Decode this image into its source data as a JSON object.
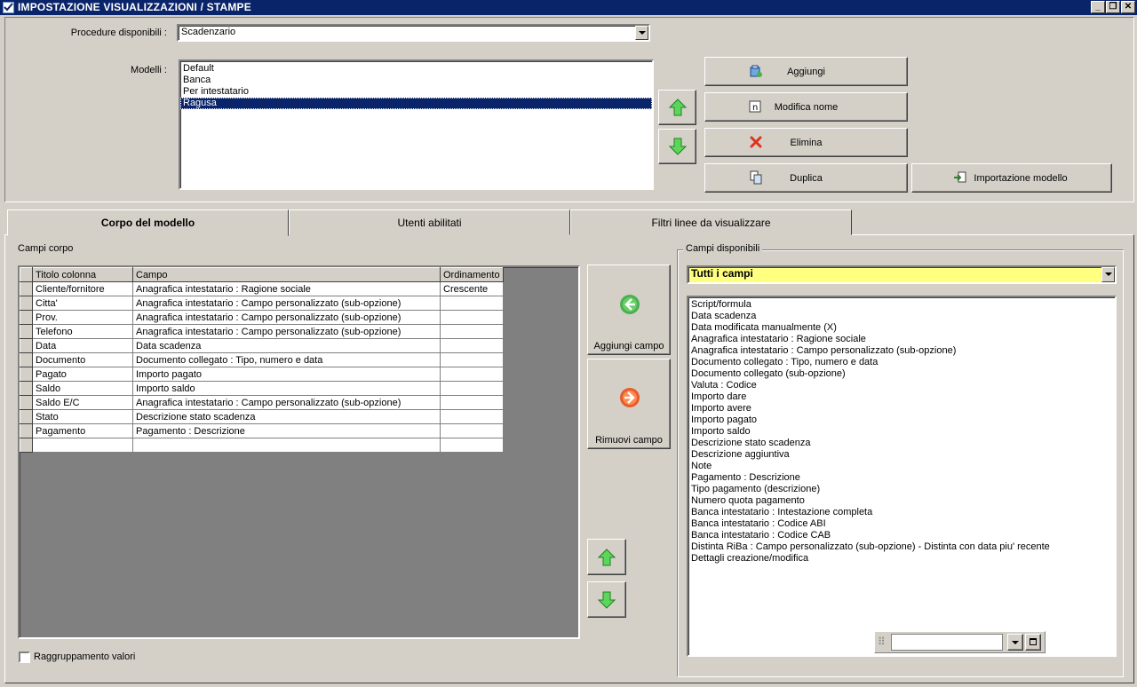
{
  "window": {
    "title": "IMPOSTAZIONE VISUALIZZAZIONI / STAMPE"
  },
  "top": {
    "procedure_label": "Procedure disponibili :",
    "procedure_value": "Scadenzario",
    "modelli_label": "Modelli :",
    "modelli": [
      {
        "label": "Default",
        "selected": false
      },
      {
        "label": "Banca",
        "selected": false
      },
      {
        "label": "Per intestatario",
        "selected": false
      },
      {
        "label": "Ragusa",
        "selected": true
      }
    ],
    "buttons": {
      "aggiungi": "Aggiungi",
      "modifica_nome": "Modifica nome",
      "elimina": "Elimina",
      "duplica": "Duplica",
      "importazione_modello": "Importazione modello"
    }
  },
  "tabs": [
    {
      "label": "Corpo del modello",
      "active": true
    },
    {
      "label": "Utenti abilitati",
      "active": false
    },
    {
      "label": "Filtri linee da visualizzare",
      "active": false
    }
  ],
  "corpo": {
    "campi_corpo_label": "Campi corpo",
    "columns": [
      "Titolo colonna",
      "Campo",
      "Ordinamento"
    ],
    "rows": [
      [
        "Cliente/fornitore",
        "Anagrafica intestatario : Ragione sociale",
        "Crescente"
      ],
      [
        "Citta'",
        "Anagrafica intestatario : Campo personalizzato (sub-opzione)",
        ""
      ],
      [
        "Prov.",
        "Anagrafica intestatario : Campo personalizzato (sub-opzione)",
        ""
      ],
      [
        "Telefono",
        "Anagrafica intestatario : Campo personalizzato (sub-opzione)",
        ""
      ],
      [
        "Data",
        "Data scadenza",
        ""
      ],
      [
        "Documento",
        "Documento collegato : Tipo, numero e data",
        ""
      ],
      [
        "Pagato",
        "Importo pagato",
        ""
      ],
      [
        "Saldo",
        "Importo saldo",
        ""
      ],
      [
        "Saldo E/C",
        "Anagrafica intestatario : Campo personalizzato (sub-opzione)",
        ""
      ],
      [
        "Stato",
        "Descrizione stato scadenza",
        ""
      ],
      [
        "Pagamento",
        "Pagamento : Descrizione",
        ""
      ],
      [
        "",
        "",
        ""
      ]
    ],
    "aggiungi_campo": "Aggiungi campo",
    "rimuovi_campo": "Rimuovi campo",
    "raggruppamento_label": "Raggruppamento valori"
  },
  "disponibili": {
    "group_label": "Campi disponibili",
    "filter_value": "Tutti i campi",
    "items": [
      "Script/formula",
      "Data scadenza",
      "Data modificata manualmente (X)",
      "Anagrafica intestatario : Ragione sociale",
      "Anagrafica intestatario : Campo personalizzato (sub-opzione)",
      "Documento collegato : Tipo, numero e data",
      "Documento collegato (sub-opzione)",
      "Valuta : Codice",
      "Importo dare",
      "Importo avere",
      "Importo pagato",
      "Importo saldo",
      "Descrizione stato scadenza",
      "Descrizione aggiuntiva",
      "Note",
      "Pagamento : Descrizione",
      "Tipo pagamento (descrizione)",
      "Numero quota pagamento",
      "Banca intestatario : Intestazione completa",
      "Banca intestatario : Codice ABI",
      "Banca intestatario : Codice CAB",
      "Distinta RiBa : Campo personalizzato (sub-opzione) - Distinta con data piu' recente",
      "Dettagli creazione/modifica"
    ],
    "search_value": ""
  },
  "colors": {
    "titlebar": "#0a246a",
    "window": "#d4d0c8",
    "filter_bg": "#ffff80",
    "arrow_green": "#2fbf2f"
  }
}
